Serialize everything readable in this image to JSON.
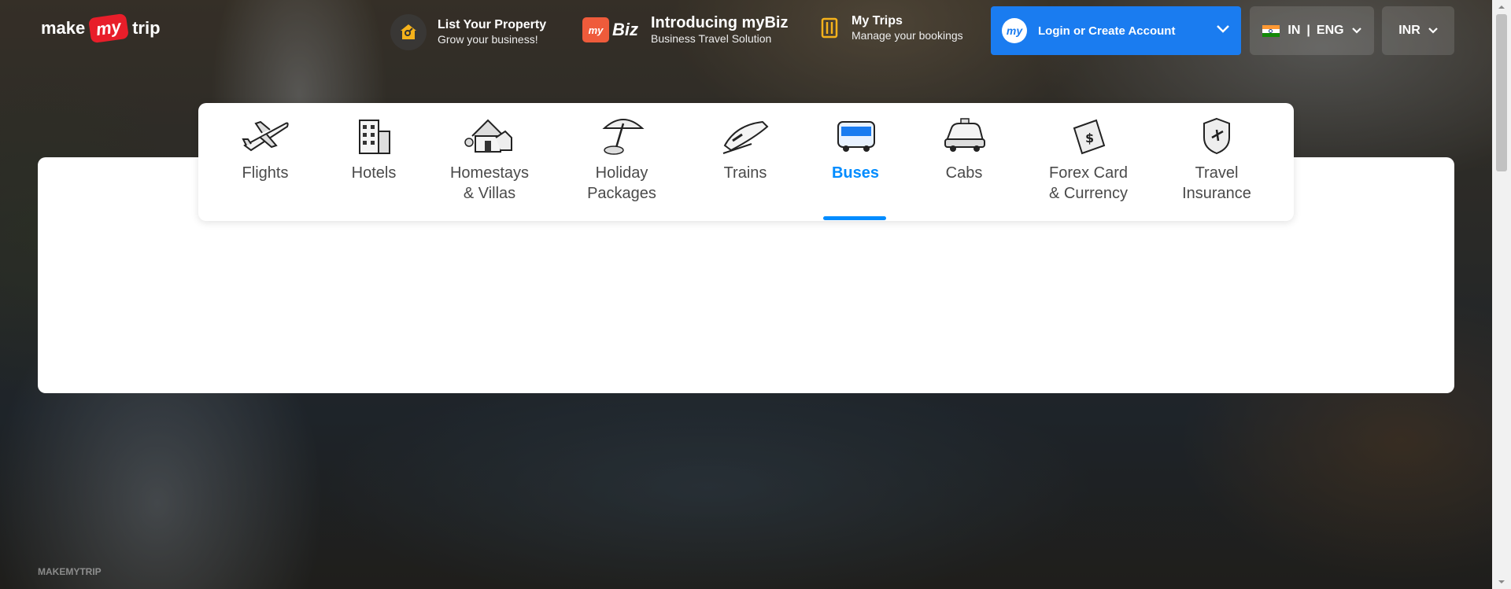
{
  "header": {
    "logo": {
      "make": "make",
      "my": "my",
      "trip": "trip"
    },
    "list_property": {
      "title": "List Your Property",
      "subtitle": "Grow your business!"
    },
    "mybiz": {
      "badge": "my",
      "word": "Biz",
      "title": "Introducing myBiz",
      "subtitle": "Business Travel Solution"
    },
    "my_trips": {
      "title": "My Trips",
      "subtitle": "Manage your bookings"
    },
    "login": {
      "badge": "my",
      "label": "Login or Create Account"
    },
    "locale": {
      "country": "IN",
      "separator": "|",
      "language": "ENG"
    },
    "currency": {
      "label": "INR"
    }
  },
  "nav": {
    "items": [
      {
        "label": "Flights",
        "icon": "airplane-icon"
      },
      {
        "label": "Hotels",
        "icon": "hotel-building-icon"
      },
      {
        "label": "Homestays\n& Villas",
        "icon": "house-icon"
      },
      {
        "label": "Holiday\nPackages",
        "icon": "beach-umbrella-icon"
      },
      {
        "label": "Trains",
        "icon": "train-icon"
      },
      {
        "label": "Buses",
        "icon": "bus-icon",
        "active": true
      },
      {
        "label": "Cabs",
        "icon": "cab-icon"
      },
      {
        "label": "Forex Card\n& Currency",
        "icon": "forex-card-icon"
      },
      {
        "label": "Travel\nInsurance",
        "icon": "insurance-shield-icon"
      }
    ],
    "active_color": "#008cff"
  },
  "footer": {
    "text": "MAKEMYTRIP"
  },
  "colors": {
    "brand_red": "#e81e2a",
    "login_blue": "#1a7cf0",
    "active_blue": "#008cff"
  }
}
